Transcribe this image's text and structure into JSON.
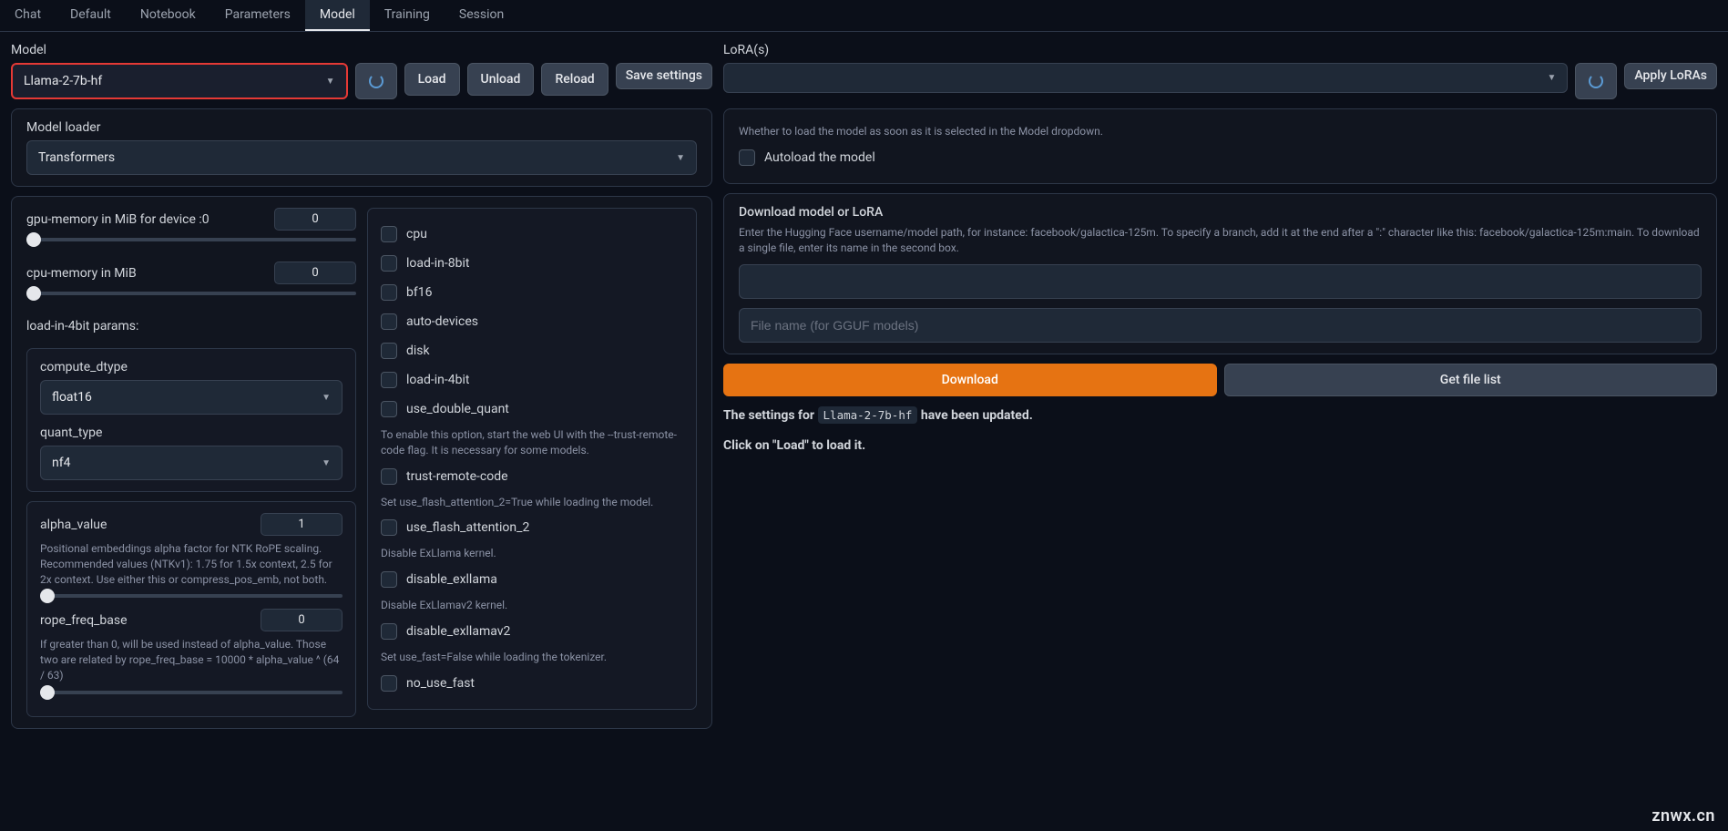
{
  "tabs": {
    "items": [
      "Chat",
      "Default",
      "Notebook",
      "Parameters",
      "Model",
      "Training",
      "Session"
    ],
    "active": "Model"
  },
  "left": {
    "model_label": "Model",
    "model_value": "Llama-2-7b-hf",
    "buttons": {
      "load": "Load",
      "unload": "Unload",
      "reload": "Reload",
      "save_settings": "Save settings"
    },
    "loader_label": "Model loader",
    "loader_value": "Transformers",
    "sliders": {
      "gpu_mem": {
        "label": "gpu-memory in MiB for device :0",
        "value": "0"
      },
      "cpu_mem": {
        "label": "cpu-memory in MiB",
        "value": "0"
      },
      "alpha": {
        "label": "alpha_value",
        "value": "1",
        "help": "Positional embeddings alpha factor for NTK RoPE scaling. Recommended values (NTKv1): 1.75 for 1.5x context, 2.5 for 2x context. Use either this or compress_pos_emb, not both."
      },
      "rope": {
        "label": "rope_freq_base",
        "value": "0",
        "help": "If greater than 0, will be used instead of alpha_value. Those two are related by rope_freq_base = 10000 * alpha_value ^ (64 / 63)"
      }
    },
    "load4bit_label": "load-in-4bit params:",
    "compute_dtype": {
      "label": "compute_dtype",
      "value": "float16"
    },
    "quant_type": {
      "label": "quant_type",
      "value": "nf4"
    },
    "checks": {
      "cpu": "cpu",
      "load8bit": "load-in-8bit",
      "bf16": "bf16",
      "auto_devices": "auto-devices",
      "disk": "disk",
      "load4bit": "load-in-4bit",
      "double_quant": "use_double_quant",
      "trust_remote": "trust-remote-code",
      "trust_remote_help": "To enable this option, start the web UI with the --trust-remote-code flag. It is necessary for some models.",
      "flash_attn": "use_flash_attention_2",
      "flash_attn_help": "Set use_flash_attention_2=True while loading the model.",
      "disable_exllama": "disable_exllama",
      "disable_exllama_help": "Disable ExLlama kernel.",
      "disable_exllamav2": "disable_exllamav2",
      "disable_exllamav2_help": "Disable ExLlamav2 kernel.",
      "no_use_fast": "no_use_fast",
      "no_use_fast_help": "Set use_fast=False while loading the tokenizer."
    }
  },
  "right": {
    "lora_label": "LoRA(s)",
    "apply_loras": "Apply LoRAs",
    "autoload_help": "Whether to load the model as soon as it is selected in the Model dropdown.",
    "autoload_label": "Autoload the model",
    "download_title": "Download model or LoRA",
    "download_help": "Enter the Hugging Face username/model path, for instance: facebook/galactica-125m. To specify a branch, add it at the end after a \":\" character like this: facebook/galactica-125m:main. To download a single file, enter its name in the second box.",
    "download_placeholder1": "",
    "download_placeholder2": "File name (for GGUF models)",
    "download_btn": "Download",
    "filelist_btn": "Get file list",
    "status1_prefix": "The settings for ",
    "status1_code": "Llama-2-7b-hf",
    "status1_suffix": " have been updated.",
    "status2": "Click on \"Load\" to load it."
  },
  "watermark": "znwx.cn"
}
